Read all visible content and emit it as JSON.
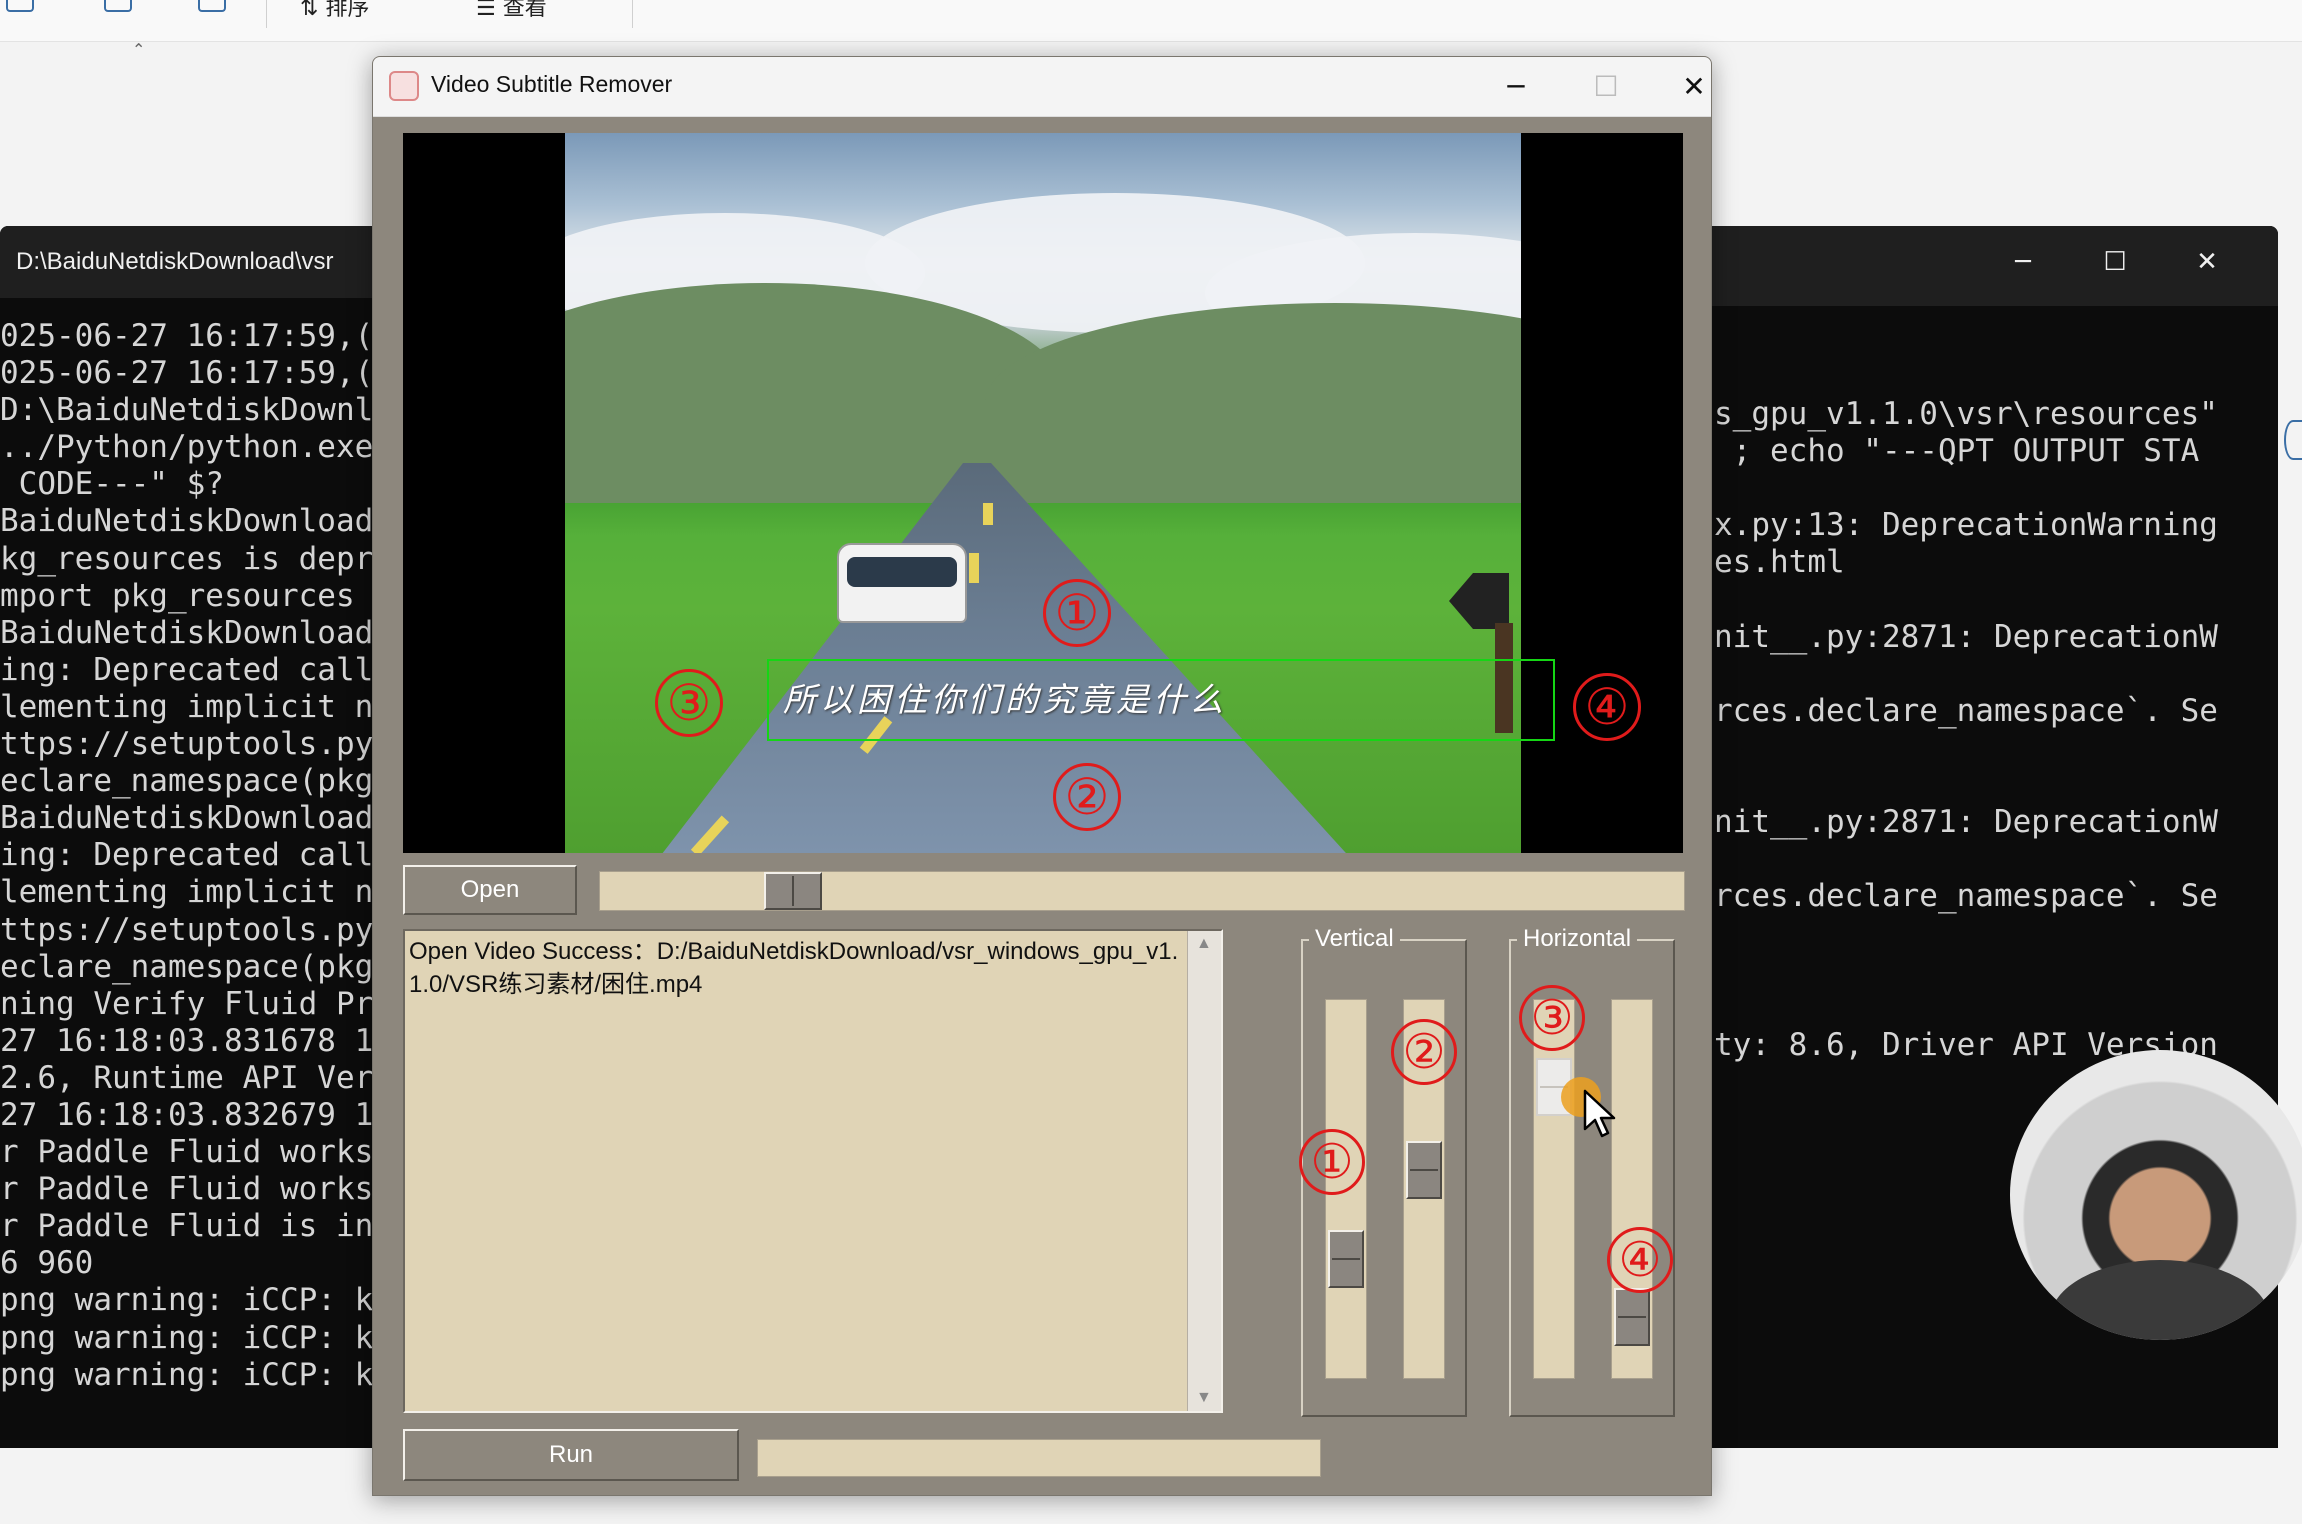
{
  "explorer": {
    "sort_label": "排序",
    "view_label": "查看"
  },
  "terminal_left": {
    "title": "D:\\BaiduNetdiskDownload\\vsr",
    "lines": [
      "025-06-27 16:17:59,(",
      "025-06-27 16:17:59,(",
      "D:\\BaiduNetdiskDownl",
      "../Python/python.exe",
      " CODE---\" $?",
      "BaiduNetdiskDownload",
      "kg_resources is depr",
      "mport pkg_resources",
      "BaiduNetdiskDownload",
      "ing: Deprecated call",
      "lementing implicit n",
      "ttps://setuptools.py",
      "eclare_namespace(pkg",
      "BaiduNetdiskDownload",
      "ing: Deprecated call",
      "lementing implicit n",
      "ttps://setuptools.py",
      "eclare_namespace(pkg",
      "ning Verify Fluid Pr",
      "27 16:18:03.831678 1",
      "2.6, Runtime API Ver",
      "27 16:18:03.832679 1",
      "r Paddle Fluid works",
      "r Paddle Fluid works",
      "r Paddle Fluid is in",
      "6 960",
      "png warning: iCCP: k",
      "png warning: iCCP: k",
      "png warning: iCCP: k"
    ]
  },
  "terminal_right": {
    "lines": [
      "s_gpu_v1.1.0\\vsr\\resources\"",
      " ; echo \"---QPT OUTPUT STA",
      "",
      "x.py:13: DeprecationWarning",
      "es.html",
      "",
      "nit__.py:2871: DeprecationW",
      "",
      "rces.declare_namespace`. Se",
      "",
      "",
      "nit__.py:2871: DeprecationW",
      "",
      "rces.declare_namespace`. Se",
      "",
      "",
      "",
      "ty: 8.6, Driver API Version"
    ]
  },
  "app": {
    "title": "Video Subtitle Remover",
    "subtitle_text": "所以困住你们的究竟是什么",
    "markers": {
      "m1": "①",
      "m2": "②",
      "m3": "③",
      "m4": "④"
    },
    "open_label": "Open",
    "run_label": "Run",
    "log_text": "Open Video Success：D:/BaiduNetdiskDownload/vsr_windows_gpu_v1.1.0/VSR练习素材/困住.mp4",
    "vertical_label": "Vertical",
    "horizontal_label": "Horizontal",
    "seek_fraction": 0.16,
    "sliders": {
      "vertical_1_fraction": 0.72,
      "vertical_2_fraction": 0.44,
      "horizontal_1_fraction": 0.18,
      "horizontal_2_fraction": 0.9
    },
    "progress_fraction": 0.0
  },
  "colors": {
    "app_bg": "#8d877d",
    "track": "#e0d4b6",
    "marker_red": "#e01b1b",
    "subtitle_box": "#15d615"
  }
}
